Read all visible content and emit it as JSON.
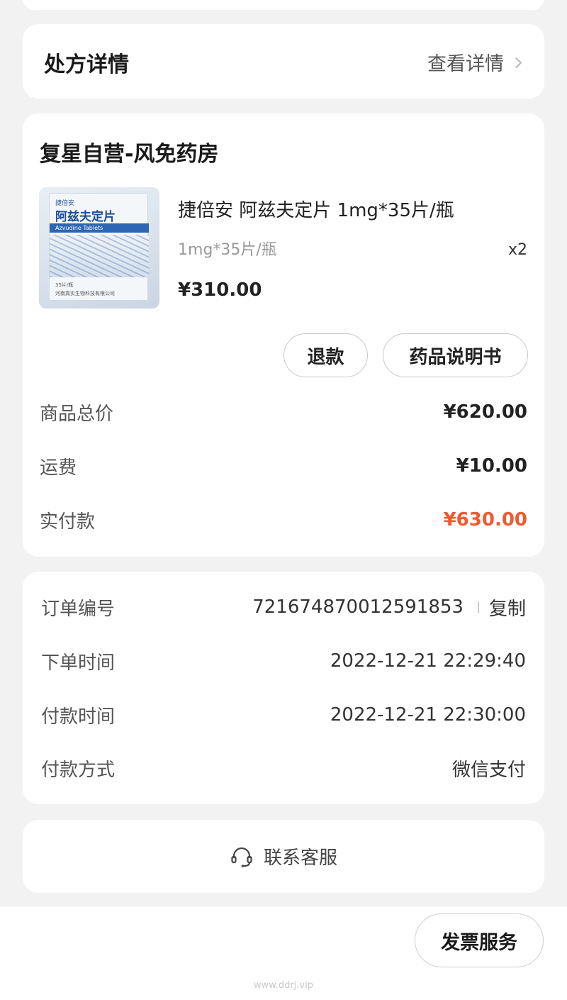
{
  "prescription": {
    "title": "处方详情",
    "link_label": "查看详情"
  },
  "order": {
    "store_name": "复星自营-风免药房",
    "product": {
      "image_icon": "medicine-box-image",
      "box_brand": "捷倍安",
      "box_title": "阿兹夫定片",
      "box_band": "Azvudine Tablets",
      "box_count": "35片/瓶",
      "box_maker": "河南真实生物科技有限公司",
      "name": "捷倍安 阿兹夫定片 1mg*35片/瓶",
      "spec": "1mg*35片/瓶",
      "qty": "x2",
      "price": "¥310.00"
    },
    "buttons": {
      "refund": "退款",
      "manual": "药品说明书"
    },
    "summary": {
      "subtotal_label": "商品总价",
      "subtotal_value": "¥620.00",
      "shipping_label": "运费",
      "shipping_value": "¥10.00",
      "paid_label": "实付款",
      "paid_value": "¥630.00"
    }
  },
  "info": {
    "order_no_label": "订单编号",
    "order_no_value": "7216748700125918​53",
    "copy_label": "复制",
    "order_time_label": "下单时间",
    "order_time_value": "2022-12-21 22:29:40",
    "pay_time_label": "付款时间",
    "pay_time_value": "2022-12-21 22:30:00",
    "pay_method_label": "付款方式",
    "pay_method_value": "微信支付"
  },
  "service": {
    "label": "联系客服",
    "icon": "headset-icon"
  },
  "footer": {
    "invoice_label": "发票服务",
    "watermark": "www.ddrj.vip"
  },
  "colors": {
    "accent": "#ee5a31",
    "background": "#f2f2f2",
    "card": "#ffffff"
  }
}
